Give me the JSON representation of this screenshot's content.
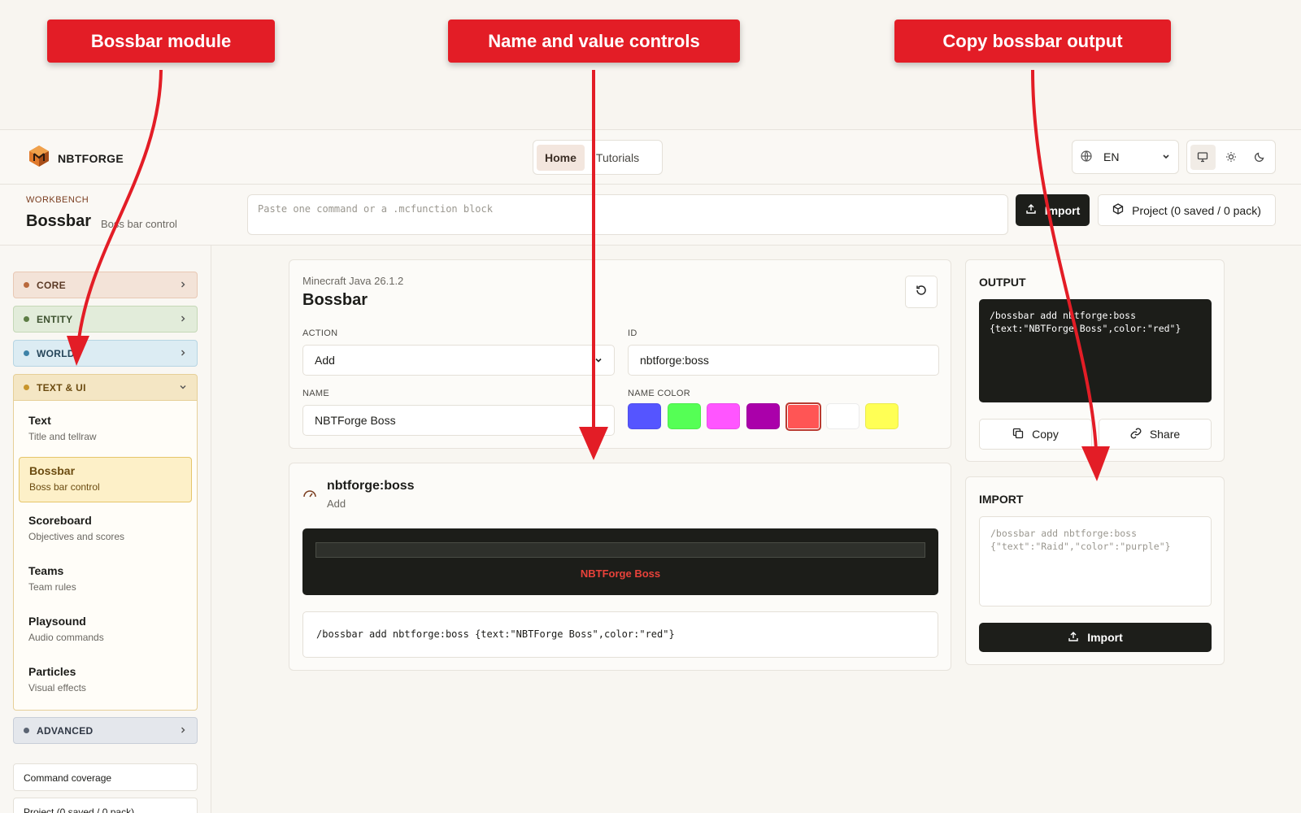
{
  "annotations": {
    "module": "Bossbar module",
    "controls": "Name and value controls",
    "output": "Copy bossbar output"
  },
  "app": {
    "brand": "NBTFORGE",
    "nav": [
      "Home",
      "Tutorials"
    ],
    "language": "EN"
  },
  "workbench": {
    "label": "WORKBENCH",
    "title": "Bossbar",
    "subtitle": "Boss bar control",
    "command_placeholder": "Paste one command or a .mcfunction block",
    "import_label": "Import",
    "project_label": "Project (0 saved / 0 pack)"
  },
  "sidebar": {
    "categories": {
      "core": "CORE",
      "entity": "ENTITY",
      "world": "WORLD",
      "text_ui": "TEXT & UI",
      "advanced": "ADVANCED"
    },
    "items": [
      {
        "title": "Text",
        "desc": "Title and tellraw"
      },
      {
        "title": "Bossbar",
        "desc": "Boss bar control"
      },
      {
        "title": "Scoreboard",
        "desc": "Objectives and scores"
      },
      {
        "title": "Teams",
        "desc": "Team rules"
      },
      {
        "title": "Playsound",
        "desc": "Audio commands"
      },
      {
        "title": "Particles",
        "desc": "Visual effects"
      }
    ],
    "coverage": "Command coverage",
    "project": "Project (0 saved / 0 pack)"
  },
  "config": {
    "version": "Minecraft Java 26.1.2",
    "title": "Bossbar",
    "action_label": "ACTION",
    "action_value": "Add",
    "id_label": "ID",
    "id_value": "nbtforge:boss",
    "name_label": "NAME",
    "name_value": "NBTForge Boss",
    "color_label": "NAME COLOR",
    "colors": [
      "#5555ff",
      "#55ff55",
      "#ff55ff",
      "#aa00aa",
      "#ff5555",
      "#ffffff",
      "#ffff55"
    ],
    "selected_color": "#ff5555"
  },
  "preview": {
    "id": "nbtforge:boss",
    "action": "Add",
    "bar_name": "NBTForge Boss",
    "bar_name_color": "#e8423a",
    "command": "/bossbar add nbtforge:boss {text:\"NBTForge Boss\",color:\"red\"}"
  },
  "output": {
    "title": "OUTPUT",
    "code": "/bossbar add nbtforge:boss\n{text:\"NBTForge Boss\",color:\"red\"}",
    "copy_label": "Copy",
    "share_label": "Share"
  },
  "import_panel": {
    "title": "IMPORT",
    "placeholder": "/bossbar add nbtforge:boss\n{\"text\":\"Raid\",\"color\":\"purple\"}",
    "button_label": "Import"
  }
}
